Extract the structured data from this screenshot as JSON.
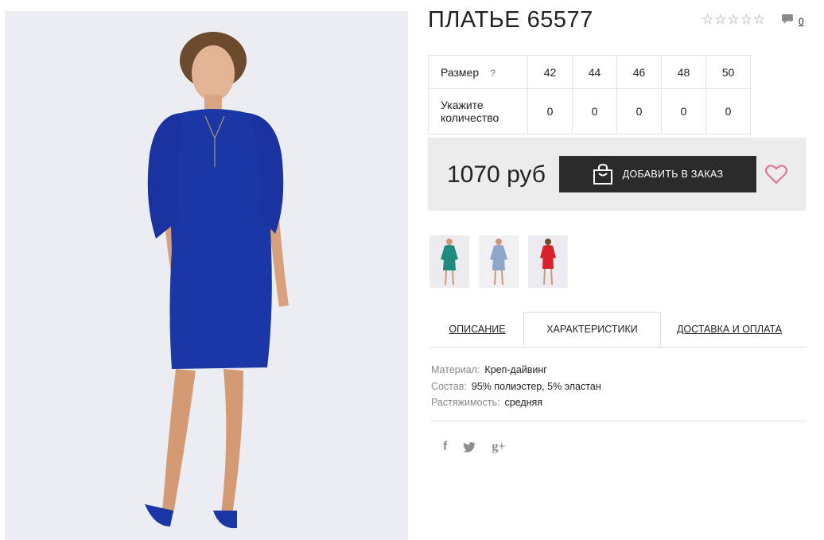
{
  "product": {
    "title": "ПЛАТЬЕ 65577",
    "rating_stars": 0,
    "comments_count": "0"
  },
  "size_table": {
    "size_label": "Размер",
    "help": "?",
    "sizes": [
      "42",
      "44",
      "46",
      "48",
      "50"
    ],
    "qty_label_line1": "Укажите",
    "qty_label_line2": "количество",
    "quantities": [
      "0",
      "0",
      "0",
      "0",
      "0"
    ]
  },
  "buy": {
    "price": "1070 руб",
    "add_button": "ДОБАВИТЬ В ЗАКАЗ"
  },
  "color_variants": [
    {
      "name": "teal-dress-thumbnail",
      "color": "#1f8a7e"
    },
    {
      "name": "lightblue-dress-thumbnail",
      "color": "#8ea6c9"
    },
    {
      "name": "red-dress-thumbnail",
      "color": "#d6202a"
    }
  ],
  "main_dress_color": "#1b37a6",
  "tabs": {
    "description": "ОПИСАНИЕ",
    "characteristics": "ХАРАКТЕРИСТИКИ",
    "delivery": "ДОСТАВКА И ОПЛАТА"
  },
  "specs": {
    "material_key": "Материал:",
    "material_val": "Креп-дайвинг",
    "composition_key": "Состав:",
    "composition_val": "95% полиэстер, 5% эластан",
    "stretch_key": "Растяжимость:",
    "stretch_val": "средняя"
  },
  "social": {
    "facebook": "f",
    "twitter": "twitter-bird",
    "googleplus": "g+"
  }
}
